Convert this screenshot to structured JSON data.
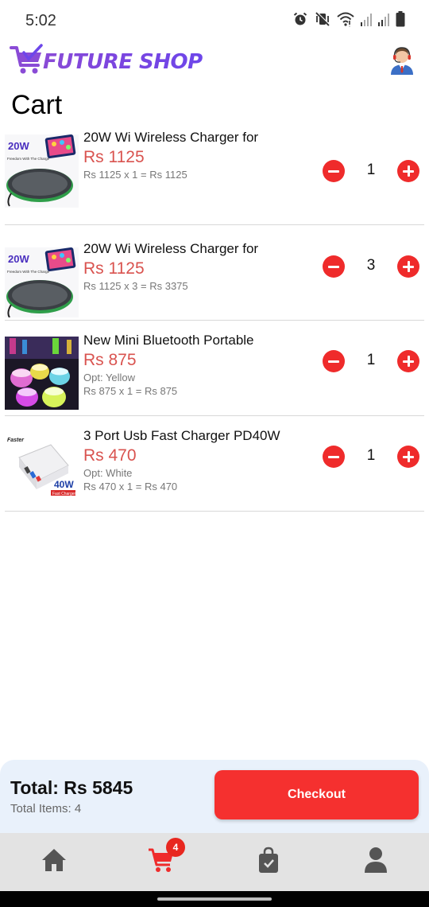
{
  "status_bar": {
    "time": "5:02",
    "icons": [
      "alarm-icon",
      "vibrate-mute-icon",
      "wifi-icon",
      "signal-icon",
      "signal-icon",
      "battery-icon"
    ]
  },
  "header": {
    "logo_text": "FUTURE SHOP",
    "logo_icon": "cart-logo-icon",
    "support_icon": "customer-support-avatar"
  },
  "page_title": "Cart",
  "cart_items": [
    {
      "title": "20W Wi Wireless Charger for",
      "price": "Rs 1125",
      "option": "",
      "calc": "Rs 1125 x 1 = Rs 1125",
      "quantity": "1",
      "thumb": "wireless-charger"
    },
    {
      "title": "20W Wi Wireless Charger for",
      "price": "Rs 1125",
      "option": "",
      "calc": "Rs 1125 x 3 = Rs 3375",
      "quantity": "3",
      "thumb": "wireless-charger"
    },
    {
      "title": "New Mini Bluetooth Portable",
      "price": "Rs 875",
      "option": "Opt:  Yellow",
      "calc": "Rs 875 x 1 = Rs 875",
      "quantity": "1",
      "thumb": "bluetooth-speaker"
    },
    {
      "title": "3 Port Usb Fast Charger PD40W",
      "price": "Rs 470",
      "option": "Opt:  White",
      "calc": "Rs 470 x 1 = Rs 470",
      "quantity": "1",
      "thumb": "usb-charger"
    }
  ],
  "thumb_text": {
    "wireless_badge": "20W",
    "wireless_caption": "Freedom With The Charge",
    "usb_brand": "Faster",
    "usb_badge": "40W",
    "usb_caption": "Fast Charger"
  },
  "checkout": {
    "total": "Total: Rs 5845",
    "total_items": "Total Items: 4",
    "button_label": "Checkout"
  },
  "bottom_nav": {
    "items": [
      {
        "name": "home",
        "icon": "home-icon"
      },
      {
        "name": "cart",
        "icon": "cart-icon",
        "badge": "4",
        "active": true
      },
      {
        "name": "orders",
        "icon": "shopping-bag-icon"
      },
      {
        "name": "profile",
        "icon": "user-icon"
      }
    ]
  },
  "colors": {
    "accent": "#ef2b2b",
    "price": "#d9534f",
    "logo": "#7a45e0",
    "panel_bg": "#e9f1fb",
    "nav_bg": "#e3e3e3",
    "nav_icon": "#555555"
  }
}
